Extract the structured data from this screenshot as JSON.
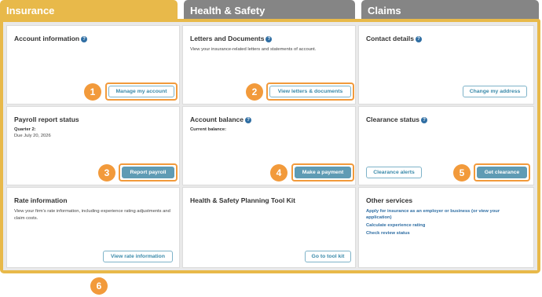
{
  "tabs": [
    {
      "label": "Insurance"
    },
    {
      "label": "Health & Safety"
    },
    {
      "label": "Claims"
    }
  ],
  "cards": {
    "account_info": {
      "title": "Account information",
      "button": "Manage my account",
      "badge": "1"
    },
    "letters": {
      "title": "Letters and Documents",
      "description": "View your insurance-related letters and statements of account.",
      "button": "View letters & documents",
      "badge": "2"
    },
    "contact": {
      "title": "Contact details",
      "button": "Change my address"
    },
    "payroll": {
      "title": "Payroll report status",
      "quarter": "Quarter 2:",
      "due": "Due July 20, 2026",
      "button": "Report payroll",
      "badge": "3"
    },
    "balance": {
      "title": "Account balance",
      "current": "Current balance:",
      "button": "Make a payment",
      "badge": "4"
    },
    "clearance": {
      "title": "Clearance status",
      "alerts_button": "Clearance alerts",
      "button": "Get clearance",
      "badge": "5"
    },
    "rate": {
      "title": "Rate information",
      "description": "View your firm's rate information, including experience rating adjustments and claim costs.",
      "button": "View rate information"
    },
    "toolkit": {
      "title": "Health & Safety Planning Tool Kit",
      "button": "Go to tool kit"
    },
    "other": {
      "title": "Other services",
      "links": [
        "Apply for insurance as an employer or business (or view your application)",
        "Calculate experience rating",
        "Check review status"
      ]
    }
  },
  "frame_badge": "6",
  "colors": {
    "accent": "#e8b94a",
    "tab_inactive": "#858585",
    "highlight": "#f29a3b",
    "button": "#5f9bb4",
    "link": "#2f6ea3"
  },
  "icons": {
    "help": "question-circle-icon"
  }
}
